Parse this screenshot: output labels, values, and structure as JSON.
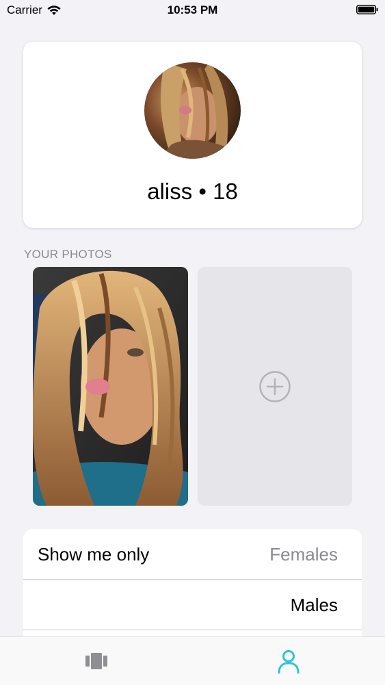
{
  "status_bar": {
    "carrier": "Carrier",
    "time": "10:53 PM",
    "wifi_icon": "wifi-icon",
    "battery_icon": "battery-icon"
  },
  "profile": {
    "name_age": "aliss • 18",
    "avatar_icon": "avatar"
  },
  "photos": {
    "header": "YOUR PHOTOS",
    "add_icon": "plus-circle-icon"
  },
  "preferences": {
    "rows": [
      {
        "label": "Show me only",
        "value": "Females",
        "selected": false
      },
      {
        "label": "",
        "value": "Males",
        "selected": true
      }
    ]
  },
  "tab_bar": {
    "tabs": [
      {
        "icon": "cards-icon",
        "active": false
      },
      {
        "icon": "profile-icon",
        "active": true
      }
    ]
  },
  "colors": {
    "accent": "#2ec4d6",
    "inactive_tab": "#8e8e93",
    "background": "#f2f2f7",
    "muted_text": "#8a8a8e"
  }
}
